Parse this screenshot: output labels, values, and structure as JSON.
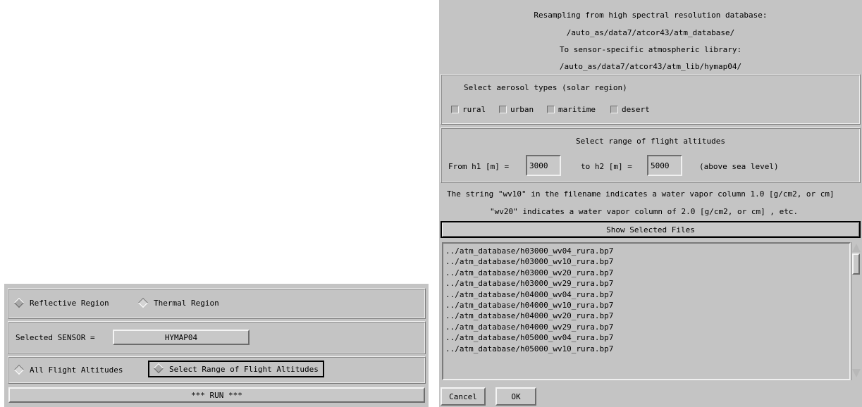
{
  "left_panel": {
    "region_options": [
      {
        "label": "Reflective Region",
        "selected": true
      },
      {
        "label": "Thermal Region",
        "selected": false
      }
    ],
    "sensor_label": "Selected SENSOR =",
    "sensor_value": "HYMAP04",
    "altitude_options": [
      {
        "label": "All Flight Altitudes",
        "selected": false
      },
      {
        "label": "Select Range of Flight Altitudes",
        "selected": true
      }
    ],
    "run_label": "***  RUN  ***"
  },
  "right_panel": {
    "header_lines": [
      "Resampling from high spectral resolution database:",
      "/auto_as/data7/atcor43/atm_database/",
      "To sensor-specific atmospheric library:",
      "/auto_as/data7/atcor43/atm_lib/hymap04/"
    ],
    "aerosol": {
      "title": "Select aerosol types (solar region)",
      "types": [
        "rural",
        "urban",
        "maritime",
        "desert"
      ]
    },
    "altitude": {
      "title": "Select range of flight altitudes",
      "h1_label": "From h1 [m] =",
      "h1_value": "3000",
      "h2_label": "to h2 [m] =",
      "h2_value": "5000",
      "note": "(above sea level)"
    },
    "info_lines": [
      "The string \"wv10\" in the filename indicates a water vapor column 1.0 [g/cm2, or cm]",
      "\"wv20\" indicates a water vapor column of 2.0 [g/cm2, or cm] , etc."
    ],
    "show_button": "Show Selected Files",
    "files": [
      "../atm_database/h03000_wv04_rura.bp7",
      "../atm_database/h03000_wv10_rura.bp7",
      "../atm_database/h03000_wv20_rura.bp7",
      "../atm_database/h03000_wv29_rura.bp7",
      "../atm_database/h04000_wv04_rura.bp7",
      "../atm_database/h04000_wv10_rura.bp7",
      "../atm_database/h04000_wv20_rura.bp7",
      "../atm_database/h04000_wv29_rura.bp7",
      "../atm_database/h05000_wv04_rura.bp7",
      "../atm_database/h05000_wv10_rura.bp7"
    ],
    "cancel_label": "Cancel",
    "ok_label": "OK"
  }
}
